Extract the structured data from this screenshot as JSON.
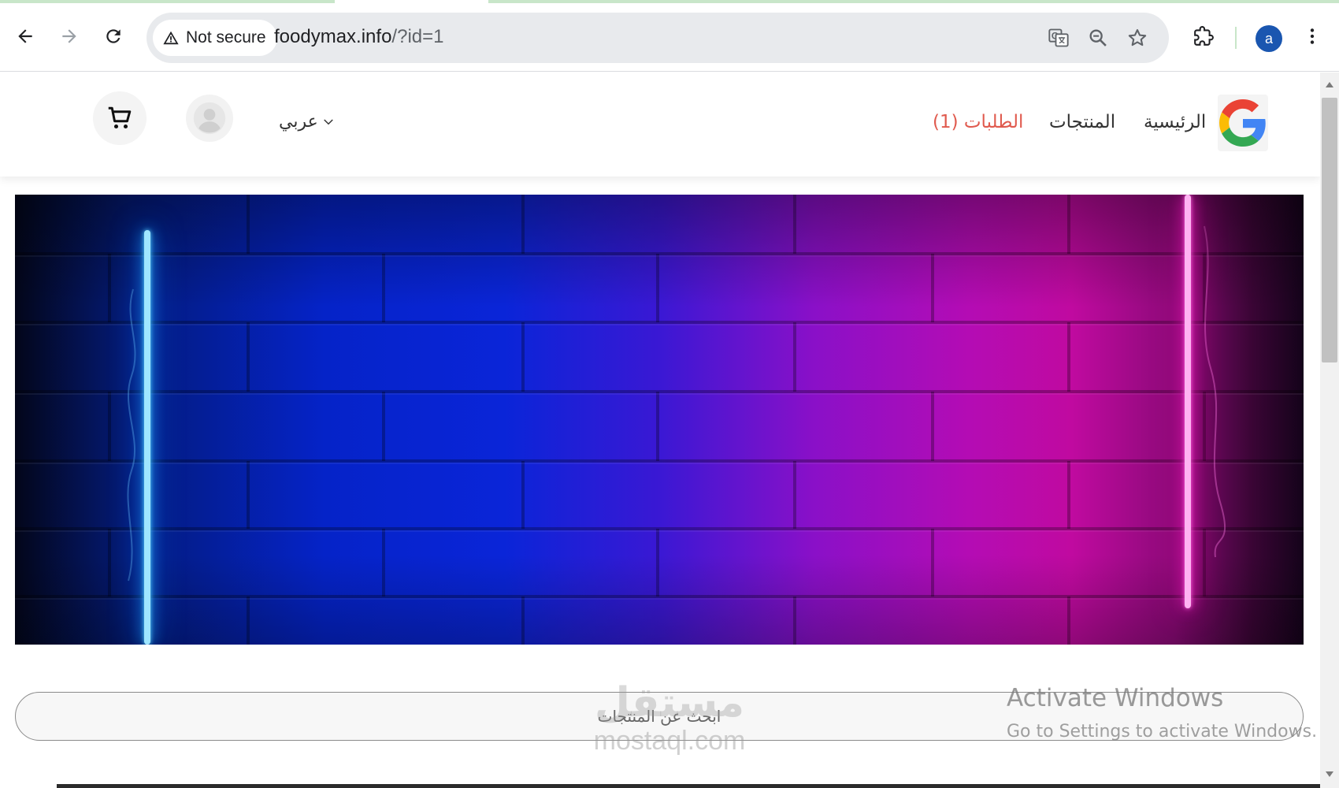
{
  "browser": {
    "security_label": "Not secure",
    "url_host": "foodymax.info",
    "url_path": "/?id=1",
    "profile_initial": "a",
    "icons": [
      "back-icon",
      "forward-icon",
      "reload-icon",
      "warning-icon",
      "translate-icon",
      "zoom-icon",
      "star-icon",
      "extensions-icon",
      "menu-icon"
    ]
  },
  "site": {
    "nav": {
      "home": "الرئيسية",
      "products": "المنتجات",
      "orders": "الطلبات (1)"
    },
    "language": "عربي",
    "search_placeholder": "ابحث عن المنتجات",
    "colors": {
      "active_link": "#e05a4e",
      "neon_blue": "#1ea8ff",
      "neon_pink": "#ff1fc8"
    }
  },
  "overlays": {
    "watermark_ar": "مستقل",
    "watermark_en": "mostaql.com",
    "activate_title": "Activate Windows",
    "activate_sub": "Go to Settings to activate Windows."
  }
}
